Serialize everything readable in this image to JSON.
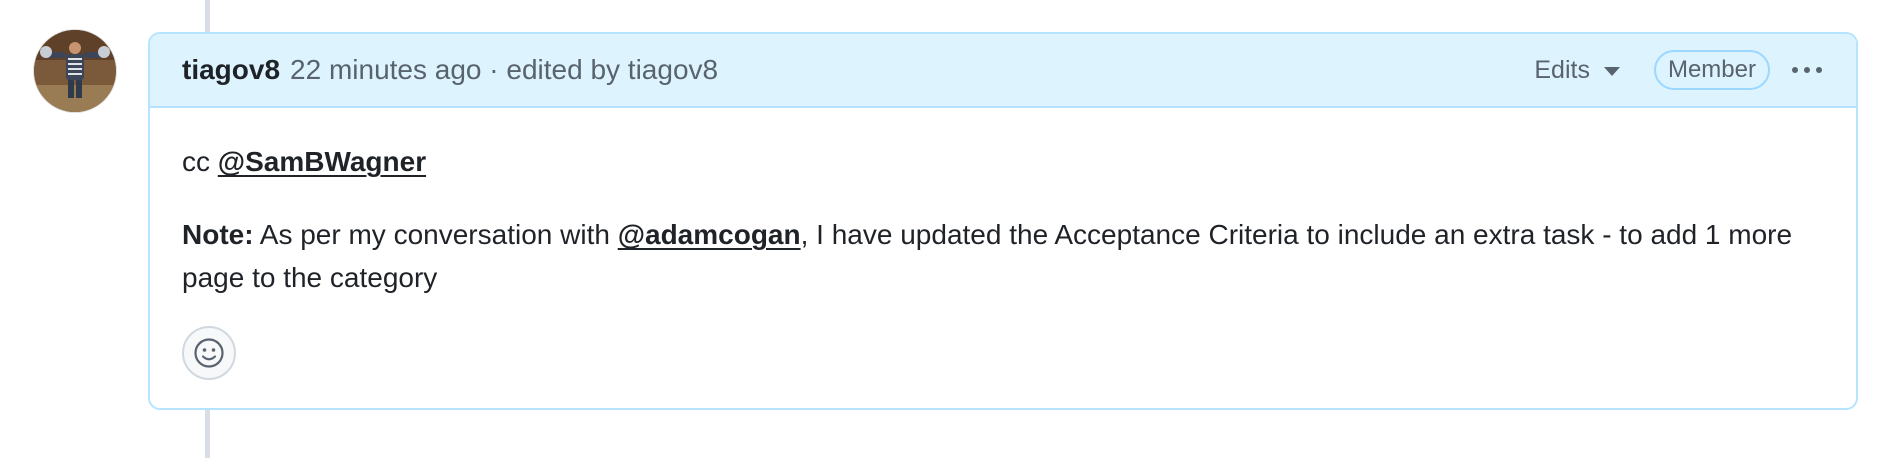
{
  "comment": {
    "author": "tiagov8",
    "timestamp": "22 minutes ago",
    "separator": "·",
    "edited_by_text": "edited by tiagov8",
    "edits_label": "Edits",
    "role_badge": "Member",
    "body": {
      "cc_prefix": "cc",
      "cc_mention": "@SamBWagner",
      "note_label": "Note:",
      "note_text_1": " As per my conversation with ",
      "note_mention": "@adamcogan",
      "note_text_2": ", I have updated the Acceptance Criteria to include an extra task - to add 1 more page to the category"
    }
  },
  "icons": {
    "avatar": "user-avatar",
    "edits_caret": "triangle-down-icon",
    "more": "kebab-horizontal-icon",
    "reaction": "smiley-icon"
  },
  "colors": {
    "header_bg": "#ddf4ff",
    "border": "#b6e3ff",
    "muted_text": "#59636e",
    "text": "#1f2328"
  }
}
